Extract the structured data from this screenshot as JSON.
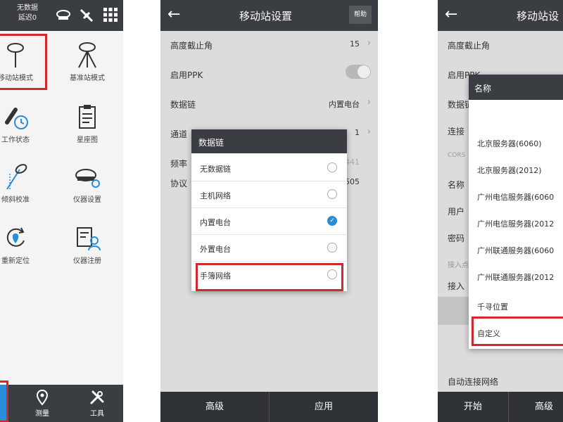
{
  "left_screen": {
    "status_line1": "无数据",
    "status_line2": "延迟0",
    "grid": [
      {
        "label": "移动站模式"
      },
      {
        "label": "基准站模式"
      },
      {
        "label": "工作状态"
      },
      {
        "label": "星座图"
      },
      {
        "label": "倾斜校准"
      },
      {
        "label": "仪器设置"
      },
      {
        "label": "重新定位"
      },
      {
        "label": "仪器注册"
      }
    ],
    "bottom_nav": [
      {
        "label": "测量"
      },
      {
        "label": "工具"
      }
    ]
  },
  "middle_screen": {
    "title": "移动站设置",
    "help_label": "帮助",
    "rows": [
      {
        "label": "高度截止角",
        "value": "15"
      },
      {
        "label": "启用PPK",
        "value": ""
      },
      {
        "label": "数据链",
        "value": "内置电台"
      },
      {
        "label": "通道",
        "value": "1"
      },
      {
        "label": "频率",
        "value": "441"
      },
      {
        "label": "协议",
        "value": "505"
      }
    ],
    "dialog": {
      "title": "数据链",
      "options": [
        {
          "label": "无数据链",
          "selected": false
        },
        {
          "label": "主机网络",
          "selected": false
        },
        {
          "label": "内置电台",
          "selected": true
        },
        {
          "label": "外置电台",
          "selected": false
        },
        {
          "label": "手簿网络",
          "selected": false
        }
      ]
    },
    "footer": {
      "advanced": "高级",
      "apply": "应用"
    }
  },
  "right_screen": {
    "title": "移动站设",
    "rows": [
      "高度截止角",
      "启用PPK",
      "数据链",
      "连接",
      "CORS",
      "名称",
      "用户",
      "密码",
      "接入点",
      "接入",
      "自动连接网络"
    ],
    "dialog": {
      "title": "名称",
      "options": [
        "北京服务器(6060)",
        "北京服务器(2012)",
        "广州电信服务器(6060",
        "广州电信服务器(2012",
        "广州联通服务器(6060",
        "广州联通服务器(2012",
        "千寻位置",
        "自定义"
      ]
    },
    "footer": {
      "start": "开始",
      "advanced": "高级"
    }
  },
  "colors": {
    "highlight": "#d0282f",
    "bar": "#3a3d42",
    "selected": "#2a8dd8"
  }
}
